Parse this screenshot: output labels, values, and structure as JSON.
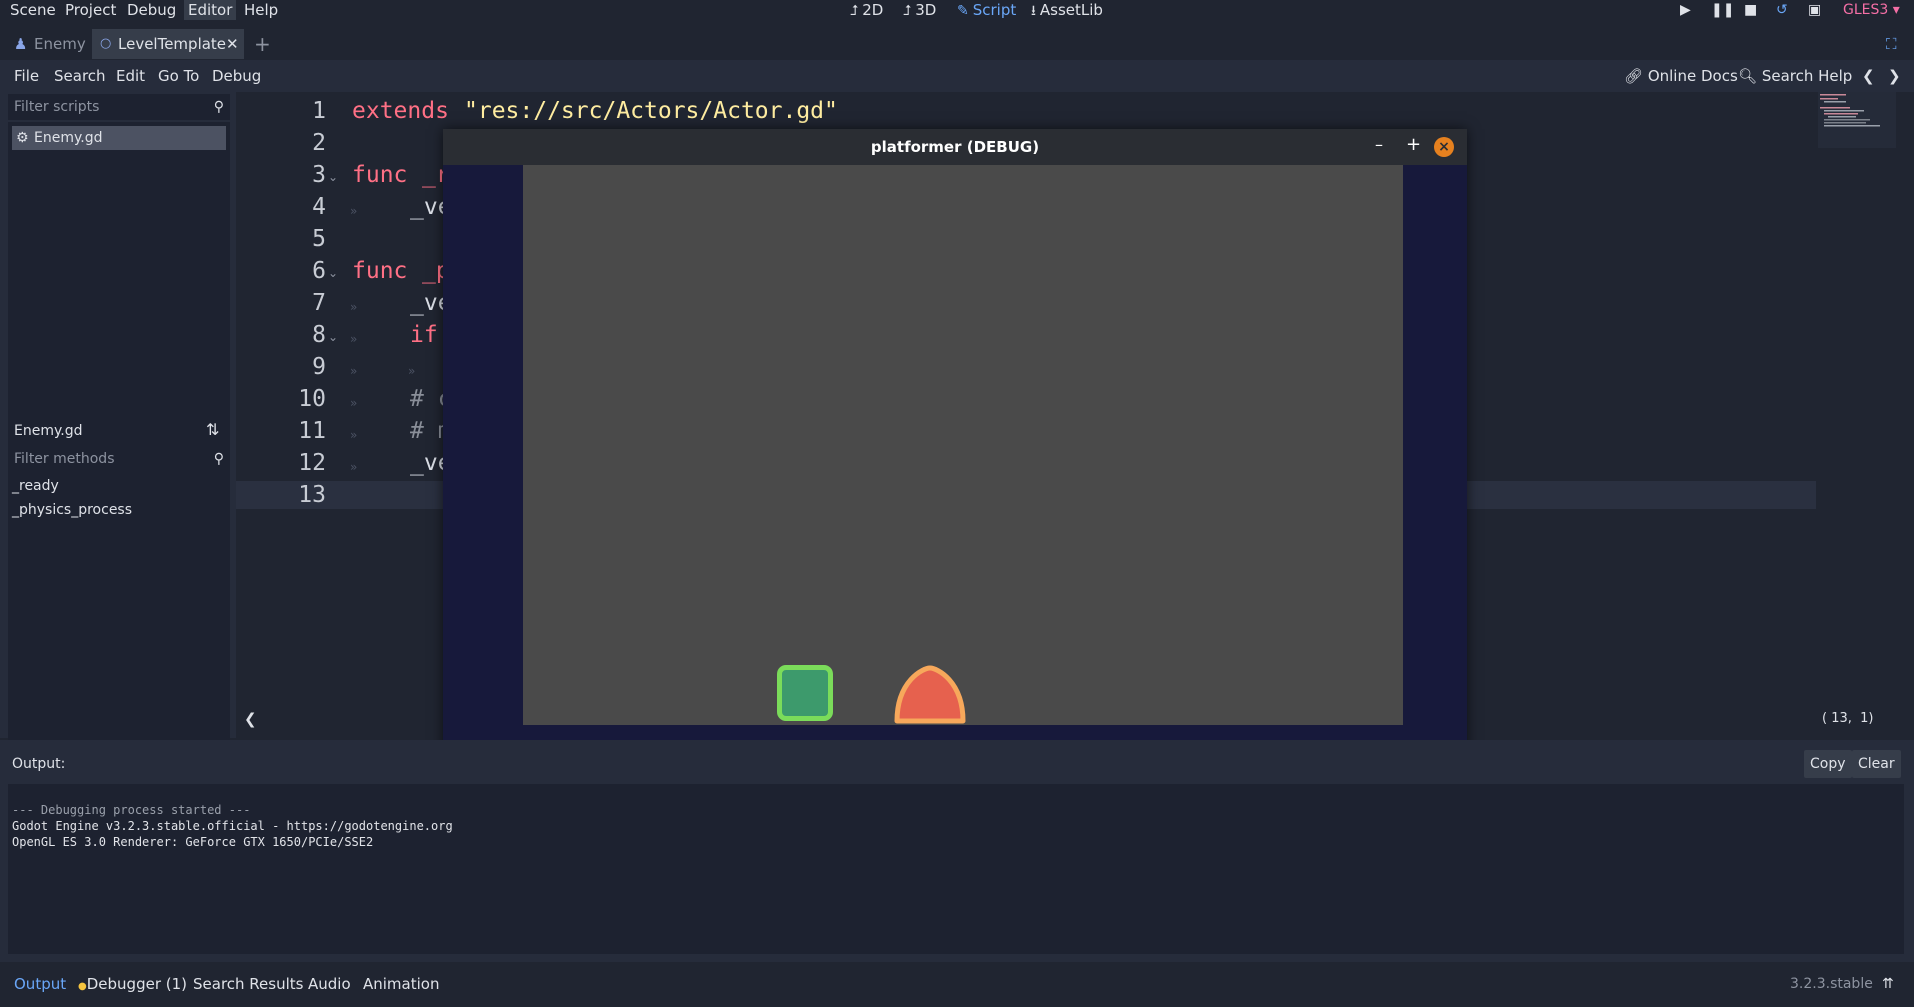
{
  "menu": {
    "items": [
      "Scene",
      "Project",
      "Debug",
      "Editor",
      "Help"
    ],
    "active": "Editor"
  },
  "modes": [
    {
      "label": "2D",
      "icon": "2d-icon"
    },
    {
      "label": "3D",
      "icon": "3d-icon"
    },
    {
      "label": "Script",
      "icon": "script-icon",
      "active": true
    },
    {
      "label": "AssetLib",
      "icon": "assetlib-icon"
    }
  ],
  "renderer": "GLES3",
  "tabs": [
    {
      "label": "Enemy",
      "icon": "enemy-scene-icon"
    },
    {
      "label": "LevelTemplate",
      "icon": "node-circle-icon",
      "active": true
    }
  ],
  "script_toolbar": {
    "menus": [
      "File",
      "Search",
      "Edit",
      "Go To",
      "Debug"
    ],
    "online_docs": "Online Docs",
    "search_help": "Search Help"
  },
  "left_panel": {
    "filter_scripts_placeholder": "Filter scripts",
    "scripts": [
      "Enemy.gd"
    ],
    "current_script": "Enemy.gd",
    "filter_methods_placeholder": "Filter methods",
    "methods": [
      "_ready",
      "_physics_process"
    ]
  },
  "editor": {
    "line_numbers": [
      "1",
      "2",
      "3",
      "4",
      "5",
      "6",
      "7",
      "8",
      "9",
      "10",
      "11",
      "12",
      "13"
    ],
    "line1_kw": "extends",
    "line1_str": "\"res://src/Actors/Actor.gd\"",
    "line3_kw": "func",
    "line3_rest": "_r",
    "line4": "_ve",
    "line6_kw": "func",
    "line6_rest": "_p",
    "line7": "_ve",
    "line8_kw": "if",
    "line10": "# c",
    "line11": "# m",
    "line12": "_ve",
    "cursor": "( 13,  1)"
  },
  "debug_window": {
    "title": "platformer (DEBUG)",
    "minimize": "–",
    "maximize": "+",
    "close": "×"
  },
  "output": {
    "label": "Output:",
    "copy": "Copy",
    "clear": "Clear",
    "lines": [
      "--- Debugging process started ---",
      "Godot Engine v3.2.3.stable.official - https://godotengine.org",
      "OpenGL ES 3.0 Renderer: GeForce GTX 1650/PCIe/SSE2"
    ]
  },
  "bottom_tabs": [
    "Output",
    "Debugger (1)",
    "Search Results",
    "Audio",
    "Animation"
  ],
  "version": "3.2.3.stable",
  "colors": {
    "accent": "#6aa7f8",
    "player_fill": "#3d9a6c",
    "player_outline": "#7bdc5a",
    "enemy_fill": "#e6614e",
    "enemy_outline": "#f7a85b",
    "close_button": "#e6811f",
    "debug_dot": "#f5c43f"
  }
}
